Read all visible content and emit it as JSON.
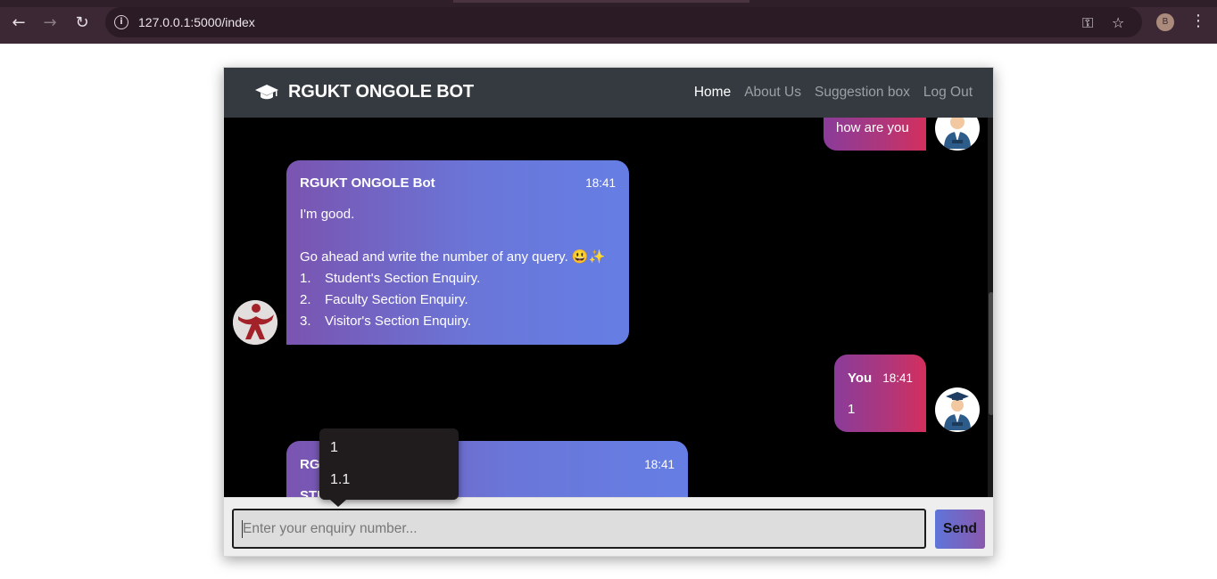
{
  "browser": {
    "url": "127.0.0.1:5000/index",
    "profile_initial": "B"
  },
  "app": {
    "brand": "RGUKT ONGOLE BOT",
    "nav": [
      {
        "label": "Home",
        "active": true
      },
      {
        "label": "About Us",
        "active": false
      },
      {
        "label": "Suggestion box",
        "active": false
      },
      {
        "label": "Log Out",
        "active": false
      }
    ]
  },
  "messages": {
    "user_top": {
      "text": "how are you"
    },
    "bot_1": {
      "name": "RGUKT ONGOLE Bot",
      "time": "18:41",
      "greeting": "I'm good.",
      "prompt": "Go ahead and write the number of any query. 😃✨",
      "options": [
        {
          "num": "1.",
          "label": "Student's Section Enquiry."
        },
        {
          "num": "2.",
          "label": "Faculty Section Enquiry."
        },
        {
          "num": "3.",
          "label": "Visitor's Section Enquiry."
        }
      ]
    },
    "user_1": {
      "name": "You",
      "time": "18:41",
      "text": "1"
    },
    "bot_2": {
      "name_partial": "RGU",
      "time": "18:41",
      "text_partial": "STU"
    }
  },
  "input": {
    "placeholder": "Enter your enquiry number...",
    "send_label": "Send"
  },
  "autocomplete": {
    "options": [
      "1",
      "1.1"
    ]
  },
  "colors": {
    "navbar": "#343a40",
    "bot_bubble_start": "#7a54b0",
    "bot_bubble_end": "#667ee4",
    "user_bubble_start": "#8a3c9a",
    "user_bubble_end": "#d42f5c"
  }
}
